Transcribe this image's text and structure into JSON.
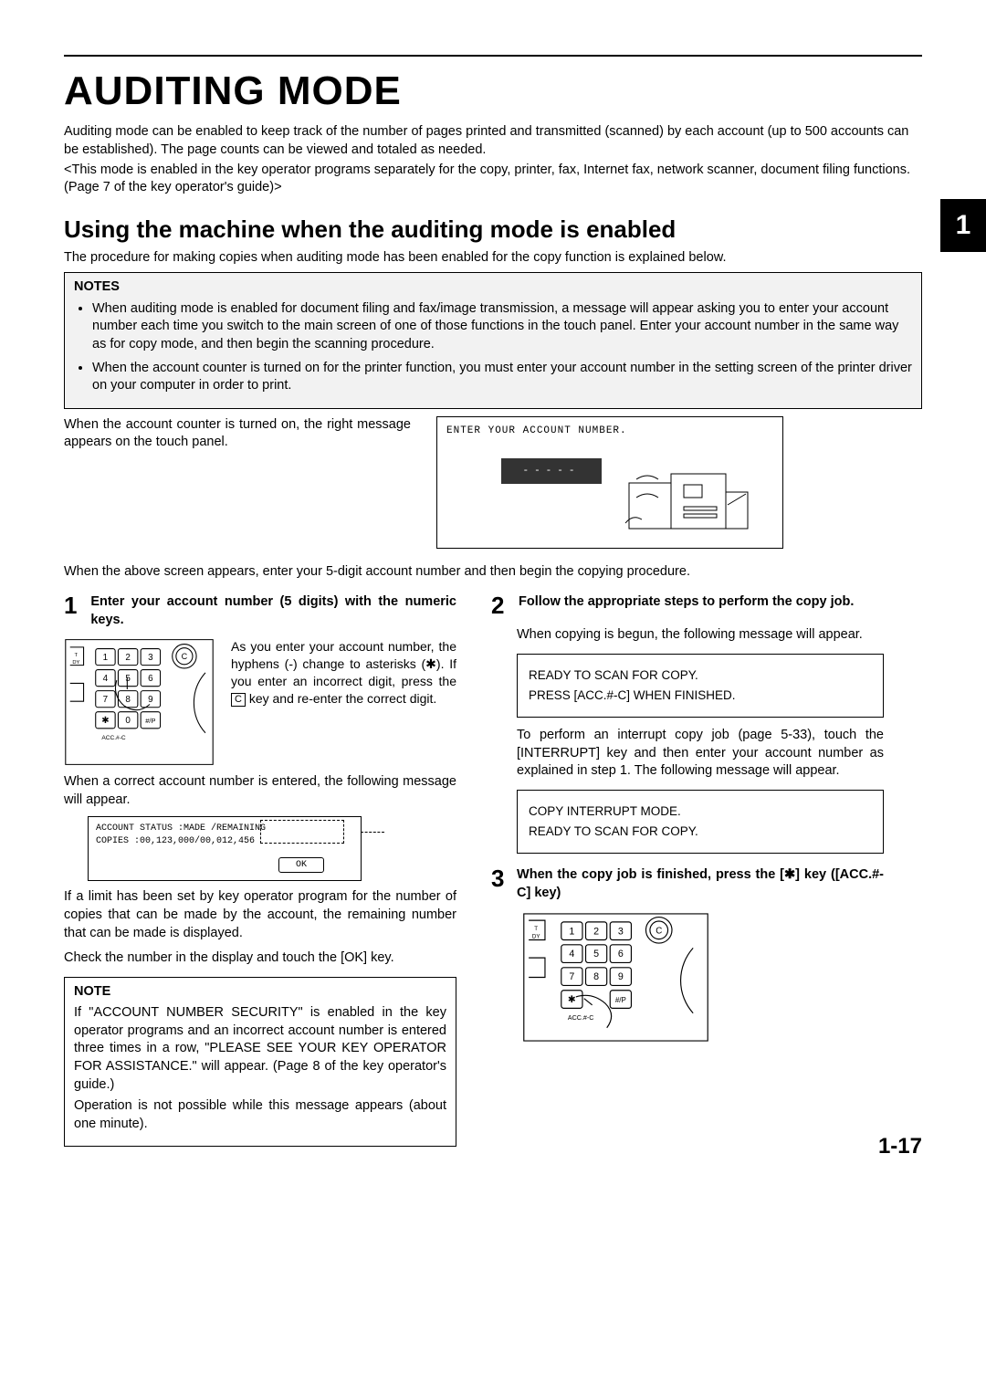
{
  "title": "AUDITING MODE",
  "chapter_tab": "1",
  "page_number": "1-17",
  "intro": {
    "p1": "Auditing mode can be enabled to keep track of the number of pages printed and transmitted (scanned) by each account (up to 500 accounts can be established). The page counts can be viewed and totaled as needed.",
    "p2": "<This mode is enabled in the key operator programs separately for the copy, printer, fax, Internet fax, network scanner, document filing functions. (Page 7 of the key operator's guide)>"
  },
  "section": {
    "heading": "Using the machine when the auditing mode is enabled",
    "lead": "The procedure for making copies when auditing mode has been enabled for the copy function is explained below."
  },
  "notes": {
    "title": "NOTES",
    "items": [
      "When auditing mode is enabled for document filing and fax/image transmission, a message will appear asking you to enter your account number each time you switch to the main screen of one of those functions in the touch panel. Enter your account number in the same way as for copy mode, and then begin the scanning procedure.",
      "When the account counter is turned on for the printer function, you must enter your account number in the setting screen of the printer driver on your computer in order to print."
    ]
  },
  "touch": {
    "text": "When the account counter is turned on, the right message appears on the touch panel.",
    "panel_header": "ENTER YOUR ACCOUNT NUMBER.",
    "dashes": "-----",
    "after": "When the above screen appears, enter your 5-digit account number and then begin the copying procedure."
  },
  "left": {
    "step1_num": "1",
    "step1_title": "Enter your account number (5 digits) with the numeric keys.",
    "step1_text_a": "As you enter your account number, the hyphens (-) change to asterisks (",
    "step1_text_b": "). If you enter an incorrect digit, press the ",
    "step1_text_c": " key and re-enter the correct digit.",
    "c_key": "C",
    "p_after_pad": "When a correct account number is entered, the following message will appear.",
    "acct_status": {
      "l1": "ACCOUNT STATUS  :MADE      /REMAINING",
      "l2": "COPIES          :00,123,000/00,012,456",
      "ok": "OK"
    },
    "p_limit": "If a limit has been set by key operator program for the number of copies that can be made by the account, the remaining number that can be made is displayed.",
    "p_check": "Check the number in the display and touch the [OK] key.",
    "note2_title": "NOTE",
    "note2_p1": "If \"ACCOUNT NUMBER SECURITY\" is enabled in the key operator programs and an incorrect account number is entered three times in a row, \"PLEASE SEE YOUR KEY OPERATOR FOR ASSISTANCE.\" will appear. (Page 8 of the key operator's guide.)",
    "note2_p2": "Operation is not possible while this message appears (about one minute)."
  },
  "right": {
    "step2_num": "2",
    "step2_title": "Follow the appropriate steps to perform the copy job.",
    "p2a": "When copying is begun, the following message will appear.",
    "box2_l1": "READY TO SCAN FOR COPY.",
    "box2_l2": "PRESS [ACC.#-C] WHEN FINISHED.",
    "p2b": "To perform an interrupt copy job (page 5-33), touch the [INTERRUPT] key and then enter your account number as explained in step 1. The following message will appear.",
    "box3_l1": "COPY INTERRUPT MODE.",
    "box3_l2": "READY TO SCAN FOR COPY.",
    "step3_num": "3",
    "step3_title_a": "When the copy job is finished, press the [",
    "step3_title_b": "] key ([ACC.#-C] key)"
  },
  "keypad": {
    "keys": [
      "1",
      "2",
      "3",
      "4",
      "5",
      "6",
      "7",
      "8",
      "9",
      "0",
      "#/P"
    ],
    "acc_label": "ACC.#-C",
    "star": "✱",
    "clear": "C"
  }
}
